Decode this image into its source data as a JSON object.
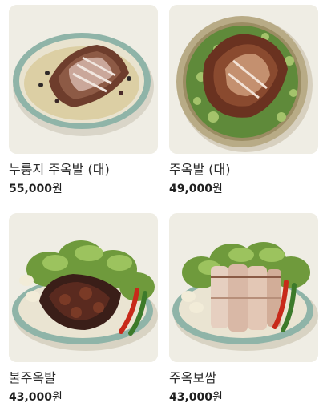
{
  "products": [
    {
      "name": "누룽지 주옥발 (대)",
      "price": "55,000",
      "currency": "원",
      "image": "jokbal-nurungji-bowl"
    },
    {
      "name": "주옥발 (대)",
      "price": "49,000",
      "currency": "원",
      "image": "jokbal-sprouts-bowl"
    },
    {
      "name": "불주옥발",
      "price": "43,000",
      "currency": "원",
      "image": "spicy-jokbal-lettuce-plate"
    },
    {
      "name": "주옥보쌈",
      "price": "43,000",
      "currency": "원",
      "image": "bossam-lettuce-plate"
    }
  ],
  "colors": {
    "photo_background": "#efede4",
    "bowl_rim": "#8fb4a8",
    "text_primary": "#222222"
  }
}
